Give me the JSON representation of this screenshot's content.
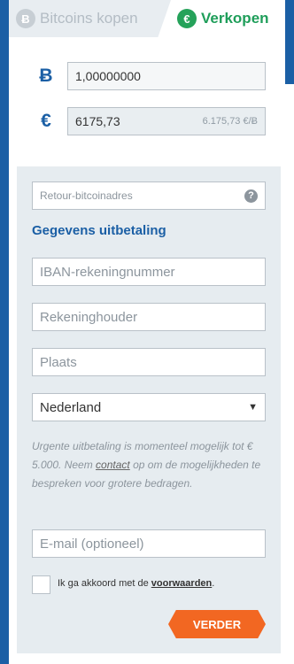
{
  "tabs": {
    "buy_label": "Bitcoins kopen",
    "buy_icon": "bitcoin-icon",
    "sell_label": "Verkopen",
    "sell_icon": "euro-icon"
  },
  "btc": {
    "symbol": "Ƀ",
    "value": "1,00000000"
  },
  "eur": {
    "symbol": "€",
    "value": "6175,73",
    "rate": "6.175,73 €/Ƀ"
  },
  "form": {
    "return_address_placeholder": "Retour-bitcoinadres",
    "help_symbol": "?",
    "section_title": "Gegevens uitbetaling",
    "iban_placeholder": "IBAN-rekeningnummer",
    "holder_placeholder": "Rekeninghouder",
    "city_placeholder": "Plaats",
    "country": "Nederland",
    "note_before": "Urgente uitbetaling is momenteel mogelijk tot € 5.000. Neem ",
    "note_link": "contact",
    "note_after": " op om de mogelijkheden te bespreken voor grotere bedragen.",
    "email_placeholder": "E-mail (optioneel)",
    "terms_before": "Ik ga akkoord met de ",
    "terms_link": "voorwaarden",
    "terms_after": ".",
    "next_label": "VERDER"
  },
  "colors": {
    "brand_blue": "#1b5fa5",
    "accent_green": "#25a25a",
    "button_orange": "#f26722"
  }
}
